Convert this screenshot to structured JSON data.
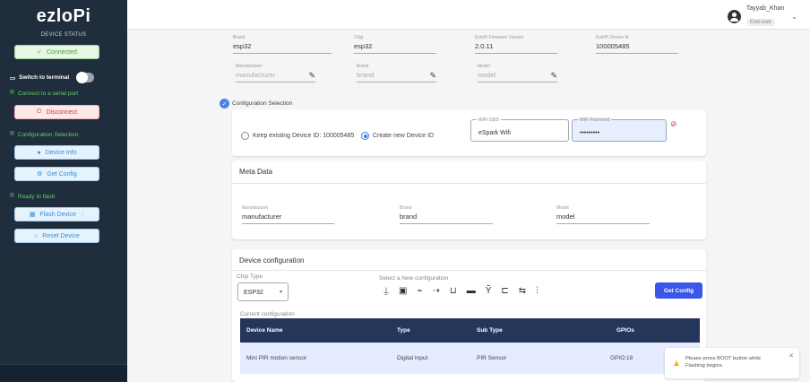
{
  "sidebar": {
    "logo": "ezloPi",
    "device_status_title": "DEVICE STATUS",
    "connected_label": "Connected",
    "switch_terminal_label": "Switch to terminal",
    "connect_serial_label": "Connect to a serial port",
    "disconnect_label": "Disconnect",
    "config_selection_label": "Configuration Selection",
    "device_info_label": "Device Info",
    "get_config_label": "Get Config",
    "ready_flash_label": "Ready to flash",
    "flash_device_label": "Flash Device",
    "reset_device_label": "Reset Device"
  },
  "header": {
    "user_name": "Tayyab_Khan",
    "user_role": "End-user"
  },
  "device": {
    "brand_label": "Brand",
    "brand_value": "esp32",
    "chip_label": "Chip",
    "chip_value": "esp32",
    "firmware_label": "EzloPi Firmware Version",
    "firmware_value": "2.0.11",
    "device_id_label": "EzloPi Device Id",
    "device_id_value": "100005485",
    "manufacturer_label": "Manufacturer",
    "manufacturer_placeholder": "manufacturer",
    "brand2_label": "Brand",
    "brand2_placeholder": "brand",
    "model_label": "Model",
    "model_placeholder": "model"
  },
  "config_selection": {
    "title": "Configuration Selection",
    "keep_existing_label": "Keep existing Device ID: 100005485",
    "create_new_label": "Create new Device ID",
    "wifi_ssid_label": "WiFi SSID",
    "wifi_ssid_value": "eSpark Wifi",
    "wifi_password_label": "WiFi Password",
    "wifi_password_value": "•••••••••"
  },
  "meta": {
    "title": "Meta Data",
    "manufacturer_label": "Manufacturer",
    "manufacturer_value": "manufacturer",
    "brand_label": "Brand",
    "brand_value": "brand",
    "model_label": "Model",
    "model_value": "model"
  },
  "device_config": {
    "title": "Device configuration",
    "chip_type_label": "Chip Type",
    "chip_type_value": "ESP32",
    "select_new_label": "Select a New configuration",
    "get_config_button": "Get Config",
    "current_config_label": "Current configuration",
    "columns": [
      "Device Name",
      "Type",
      "Sub Type",
      "GPIOs"
    ],
    "rows": [
      [
        "Mini PIR motion sensor",
        "Digital Input",
        "PIR Sensor",
        "GPIO:18"
      ]
    ]
  },
  "toast": {
    "message": "Please press BOOT button while Flashing begins."
  }
}
